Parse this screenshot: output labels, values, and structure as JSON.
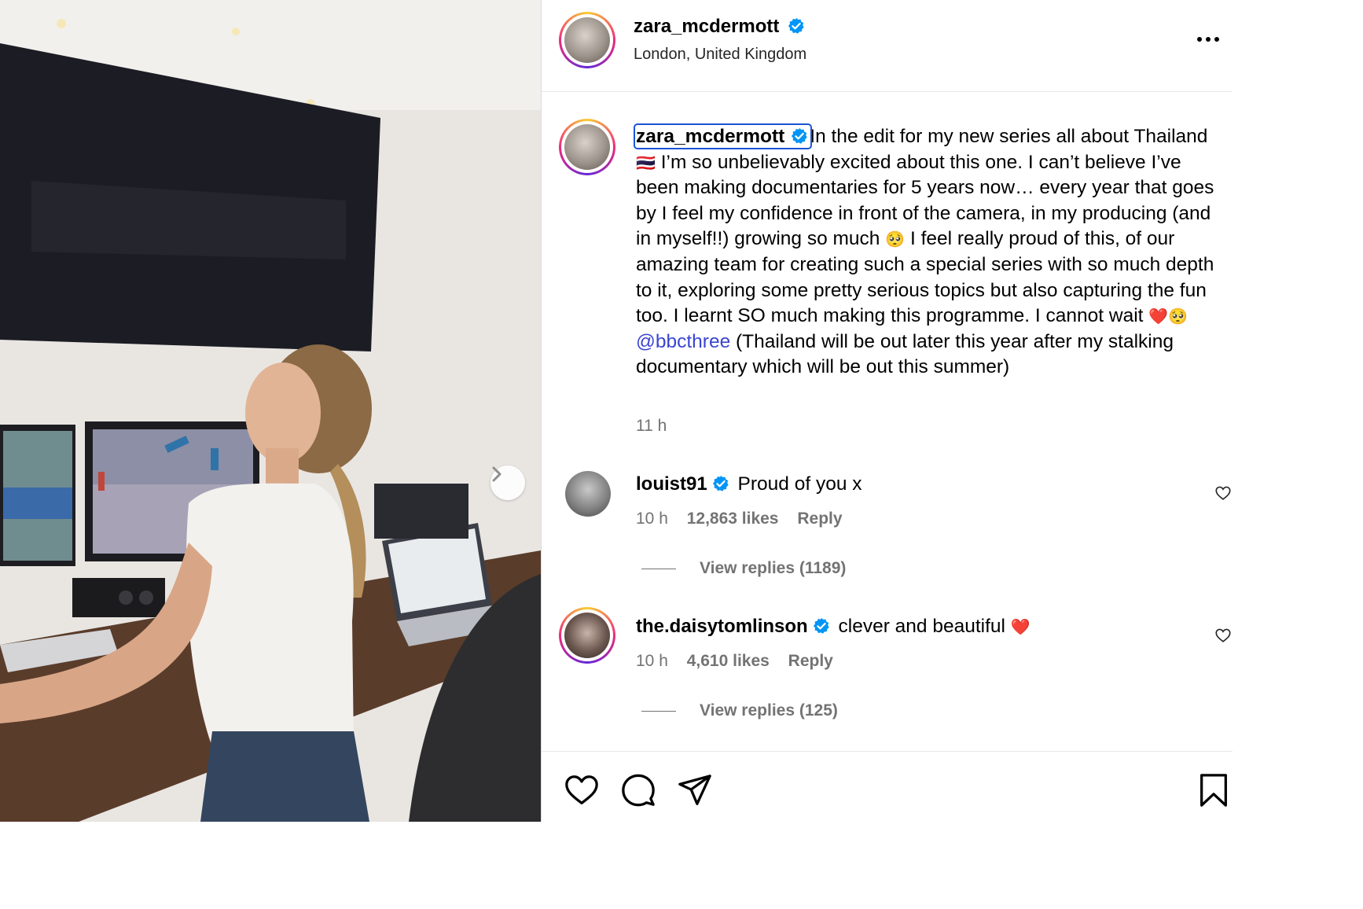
{
  "post": {
    "username": "zara_mcdermott",
    "location": "London, United Kingdom",
    "caption_part1": "In the edit for my new series all about Thailand ",
    "caption_part2": " I’m so unbelievably excited about this one. I can’t believe I’ve been making documentaries for 5 years now… every year that goes by I feel my confidence in front of the camera, in my producing (and in myself!!) growing so much ",
    "caption_part3": " I feel really proud of this, of our amazing team for creating such a special series with so much depth to it, exploring some pretty serious topics but also capturing the fun too. I learnt SO much making this programme. I cannot wait ",
    "caption_mention": "@bbcthree",
    "caption_part4": " (Thailand will be out later this year after my stalking documentary which will be out this summer)",
    "time": "11 h",
    "emoji_flag": "🇹🇭",
    "emoji_pleading": "🥺",
    "emoji_heart": "❤️"
  },
  "comments": [
    {
      "username": "louist91",
      "text": "Proud of you x",
      "time": "10 h",
      "likes": "12,863 likes",
      "reply_label": "Reply",
      "view_replies": "View replies (1189)"
    },
    {
      "username": "the.daisytomlinson",
      "text": "clever and beautiful ",
      "emoji": "❤️",
      "time": "10 h",
      "likes": "4,610 likes",
      "reply_label": "Reply",
      "view_replies": "View replies (125)"
    }
  ],
  "colors": {
    "verified": "#0095f6",
    "mention": "#3b45d1",
    "focus_outline": "#1a55d6"
  },
  "icons": [
    "verified-icon",
    "more-options-icon",
    "chevron-right-icon",
    "heart-icon",
    "comment-icon",
    "share-icon",
    "bookmark-icon"
  ]
}
